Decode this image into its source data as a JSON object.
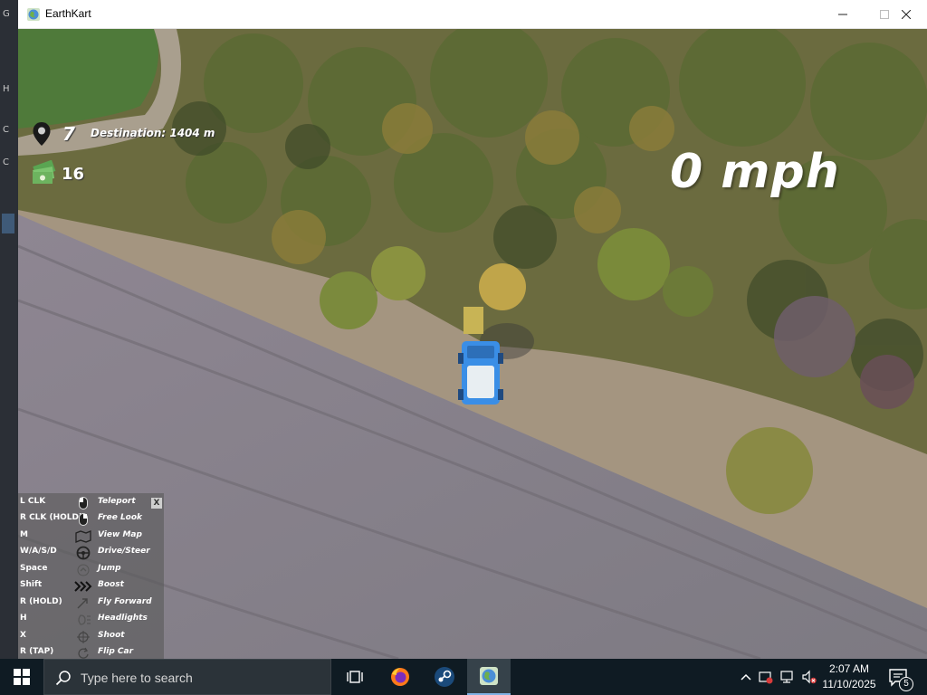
{
  "window": {
    "title": "EarthKart"
  },
  "hud": {
    "destinations_remaining": "7",
    "destination_distance": "Destination: 1404 m",
    "cash": "16",
    "speed": "0 mph"
  },
  "controls": {
    "close_label": "X",
    "rows": [
      {
        "key": "L CLK",
        "icon": "mouse-left-icon",
        "action": "Teleport"
      },
      {
        "key": "R CLK (HOLD)",
        "icon": "mouse-right-icon",
        "action": "Free Look"
      },
      {
        "key": "M",
        "icon": "map-icon",
        "action": "View Map"
      },
      {
        "key": "W/A/S/D",
        "icon": "steering-wheel-icon",
        "action": "Drive/Steer"
      },
      {
        "key": "Space",
        "icon": "jump-icon",
        "action": "Jump"
      },
      {
        "key": "Shift",
        "icon": "boost-chevrons-icon",
        "action": "Boost"
      },
      {
        "key": "R (HOLD)",
        "icon": "fly-forward-icon",
        "action": "Fly Forward"
      },
      {
        "key": "H",
        "icon": "headlights-icon",
        "action": "Headlights"
      },
      {
        "key": "X",
        "icon": "crosshair-icon",
        "action": "Shoot"
      },
      {
        "key": "R (TAP)",
        "icon": "flip-icon",
        "action": "Flip Car"
      }
    ]
  },
  "taskbar": {
    "search_placeholder": "Type here to search",
    "apps": [
      "task-view-icon",
      "firefox-icon",
      "steam-icon",
      "earthkart-icon"
    ],
    "time": "2:07 AM",
    "date": "11/10/2025",
    "notification_count": "5"
  },
  "colors": {
    "taskbar": "#0f1b23",
    "car_blue": "#3a8ee6",
    "hud_text": "#ffffff"
  }
}
